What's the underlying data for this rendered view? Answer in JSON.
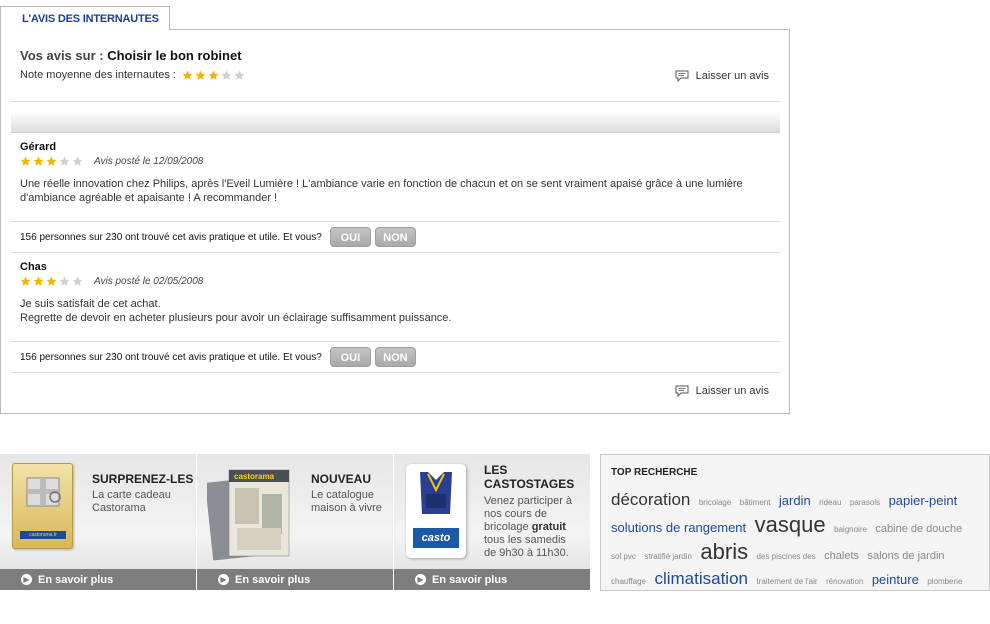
{
  "tab": {
    "label": "L'AVIS DES INTERNAUTES"
  },
  "header": {
    "prefix": "Vos avis sur : ",
    "subject": "Choisir le bon robinet",
    "avg_label": "Note moyenne des internautes :",
    "avg_rating": 3,
    "leave_review": "Laisser un avis"
  },
  "reviews": [
    {
      "author": "Gérard",
      "rating": 3,
      "date": "Avis posté le 12/09/2008",
      "body": "Une réelle innovation chez Philips, après l'Eveil Lumière ! L'ambiance varie en fonction de chacun et on se sent vraiment apaisé grâce à une lumière d'ambiance agréable et apaisante ! A recommander !",
      "useful_text": "156 personnes sur 230 ont trouvé cet avis pratique et utile. Et vous?",
      "yes": "OUI",
      "no": "NON"
    },
    {
      "author": "Chas",
      "rating": 3,
      "date": "Avis posté le 02/05/2008",
      "body": "Je suis satisfait de cet achat.\nRegrette de devoir en acheter plusieurs pour avoir un éclairage suffisamment puissance.",
      "useful_text": "156 personnes sur 230 ont trouvé cet avis pratique et utile. Et vous?",
      "yes": "OUI",
      "no": "NON"
    }
  ],
  "footer_leave_review": "Laisser un avis",
  "promos": [
    {
      "title": "SURPRENEZ-LES",
      "text": "La carte cadeau Castorama",
      "image_text": "castorama.fr",
      "link": "En savoir plus"
    },
    {
      "title": "NOUVEAU",
      "text": "Le catalogue maison à vivre",
      "image_text": "castorama",
      "link": "En savoir plus"
    },
    {
      "title": "LES CASTOSTAGES",
      "text_before": "Venez participer à nos cours de bricolage ",
      "text_bold": "gratuit",
      "text_after": " tous les samedis de 9h30 à 11h30.",
      "image_text": "casto",
      "link": "En savoir plus"
    }
  ],
  "top_search": {
    "title": "TOP RECHERCHE",
    "tags": [
      {
        "label": "décoration",
        "size": "l"
      },
      {
        "label": "bricolage",
        "size": "xs"
      },
      {
        "label": "bâtiment",
        "size": "xs"
      },
      {
        "label": "jardin",
        "size": "m"
      },
      {
        "label": "rideau",
        "size": "xs"
      },
      {
        "label": "parasols",
        "size": "xs"
      },
      {
        "label": "papier-peint",
        "size": "m"
      },
      {
        "label": "solutions de rangement",
        "size": "m"
      },
      {
        "label": "vasque",
        "size": "xl"
      },
      {
        "label": "baignoire",
        "size": "xs"
      },
      {
        "label": "cabine de douche",
        "size": "s"
      },
      {
        "label": "sol pvc",
        "size": "xs"
      },
      {
        "label": "stratifié jardin",
        "size": "xs"
      },
      {
        "label": "abris",
        "size": "xl"
      },
      {
        "label": "des piscines des",
        "size": "xs"
      },
      {
        "label": "chalets",
        "size": "s"
      },
      {
        "label": "salons de jardin",
        "size": "s"
      },
      {
        "label": "chauffage",
        "size": "xs"
      },
      {
        "label": "climatisation",
        "size": "lb"
      },
      {
        "label": "traitement de l'air",
        "size": "xs"
      },
      {
        "label": "rénovation",
        "size": "xs"
      },
      {
        "label": "peinture",
        "size": "m"
      },
      {
        "label": "plomberie",
        "size": "xs"
      }
    ]
  },
  "colors": {
    "accent": "#1d4a9b",
    "star_on": "#f5b400",
    "star_off": "#cfcfcf",
    "footer_bar": "#7d7d7d"
  }
}
